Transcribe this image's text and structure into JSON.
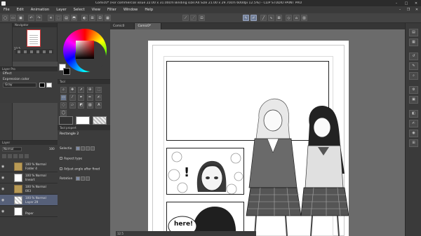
{
  "window": {
    "title": "Comic0* (For commercial issue 22.00 x 31.00cm Binding size:A4 Size 21.00 x 29.70cm 600dpi 12.5%) - CLIP STUDIO PAINT PRO",
    "minimize": "–",
    "maximize": "□",
    "close": "✕"
  },
  "menu": [
    "File",
    "Edit",
    "Animation",
    "Layer",
    "Select",
    "View",
    "Filter",
    "Window",
    "Help"
  ],
  "navigator": {
    "tab": "Navigator",
    "zoom": "12.5"
  },
  "expression": {
    "tab": "Layer Pro",
    "effect_label": "Effect",
    "label": "Expression color",
    "value": "Gray",
    "colors": {
      "black": "#000000",
      "white": "#ffffff"
    }
  },
  "subtool": {
    "tab": "Tool"
  },
  "tool_property": {
    "tab": "Tool propert",
    "name": "Rectangle 2",
    "selection_label": "Selectio",
    "aspect_label": "Aspect type",
    "adjust_label": "Adjust angle after fixed",
    "rotation_label": "Rotation"
  },
  "layers": {
    "tab": "Layer",
    "blend": "Normal",
    "opacity": "100",
    "items": [
      {
        "line1": "100 % Normal",
        "line2": "Folder 4",
        "type": "folder",
        "selected": false
      },
      {
        "line1": "100 % Normal",
        "line2": "lineart",
        "type": "layer",
        "selected": false
      },
      {
        "line1": "100 % Normal",
        "line2": "003",
        "type": "folder",
        "selected": false
      },
      {
        "line1": "100 % Normal",
        "line2": "Layer 29",
        "type": "layer",
        "selected": true
      },
      {
        "line1": "",
        "line2": "Paper",
        "type": "paper",
        "selected": false
      }
    ]
  },
  "canvas": {
    "tabs": [
      "Comic0",
      "Comic0*"
    ],
    "active_tab": 1,
    "page_color": "#ffffff",
    "speech_text": "here!"
  },
  "right_dock": {
    "icons": [
      "layer-icon",
      "material-icon",
      "history-icon",
      "tool-icon",
      "search-icon",
      "settings-icon",
      "panel-icon",
      "color-set-icon",
      "brush-icon",
      "stamp-icon",
      "grid-icon"
    ]
  },
  "status": {
    "zoom": "12.5"
  }
}
